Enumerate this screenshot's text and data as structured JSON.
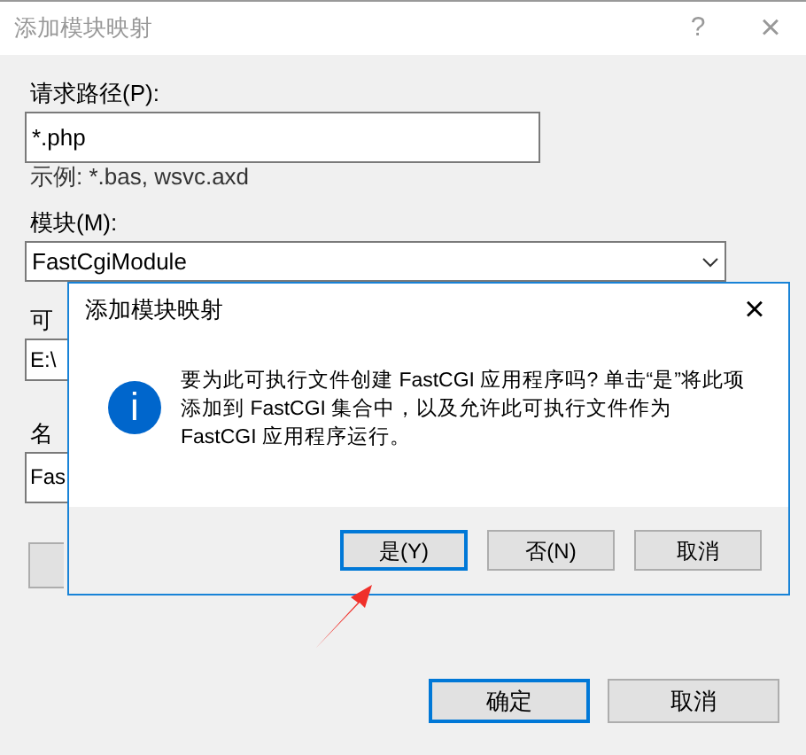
{
  "window": {
    "title": "添加模块映射",
    "help": "?",
    "close": "×"
  },
  "form": {
    "request_path_label": "请求路径(P):",
    "request_path_value": "*.php",
    "example": "示例: *.bas, wsvc.axd",
    "module_label": "模块(M):",
    "module_value": "FastCgiModule",
    "executable_label": "可",
    "executable_value": "E:\\",
    "name_label": "名",
    "name_value": "Fas"
  },
  "buttons": [
    {
      "label": "确定",
      "selected": true
    },
    {
      "label": "取消",
      "selected": false
    }
  ],
  "message_box": {
    "title": "添加模块映射",
    "close": "×",
    "icon": "i",
    "message": "要为此可执行文件创建 FastCGI 应用程序吗? 单击“是”将此项添加到 FastCGI 集合中，以及允许此可执行文件作为 FastCGI 应用程序运行。",
    "buttons": [
      {
        "label": "是(Y)",
        "selected": true
      },
      {
        "label": "否(N)",
        "selected": false
      },
      {
        "label": "取消",
        "selected": false
      }
    ]
  }
}
